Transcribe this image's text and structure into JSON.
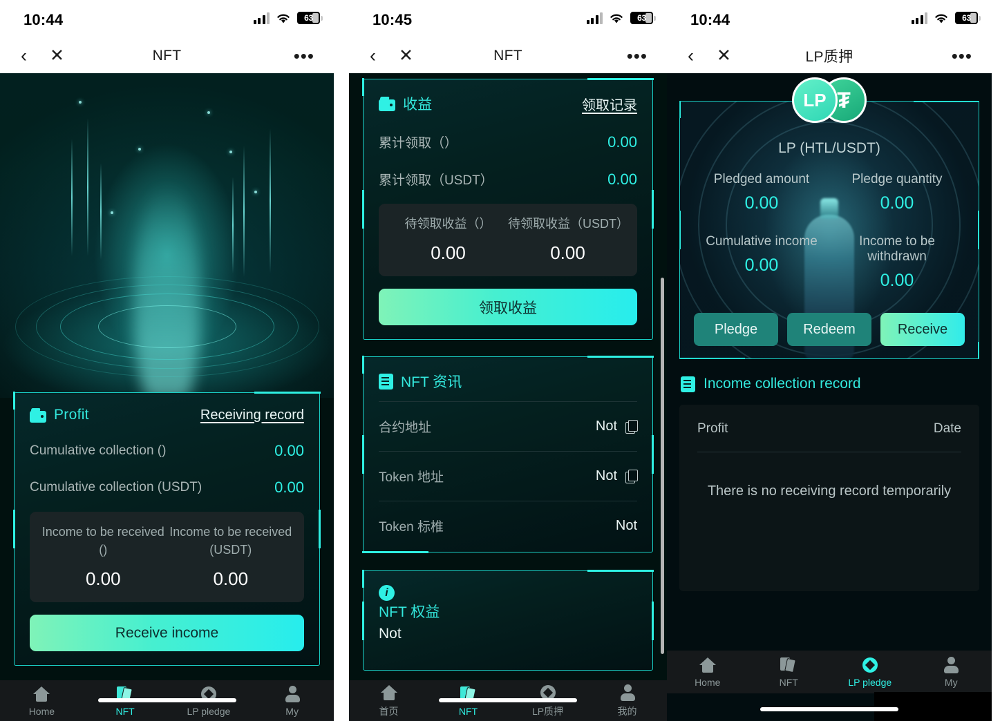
{
  "status_bar": {
    "time_1": "10:44",
    "time_2": "10:45",
    "time_3": "10:44",
    "battery": "63"
  },
  "panel1": {
    "nav": {
      "back": "‹",
      "close": "✕",
      "title": "NFT",
      "more": "•••"
    },
    "hero_alt": "nft-portal-artwork",
    "profit_card": {
      "icon": "wallet-icon",
      "title": "Profit",
      "record_link": "Receiving record",
      "rows": [
        {
          "label": "Cumulative collection ()",
          "value": "0.00"
        },
        {
          "label": "Cumulative collection (USDT)",
          "value": "0.00"
        }
      ],
      "pending": [
        {
          "label": "Income to be received ()",
          "value": "0.00"
        },
        {
          "label": "Income to be received (USDT)",
          "value": "0.00"
        }
      ],
      "button": "Receive income"
    },
    "tabs": [
      {
        "label": "Home",
        "icon": "home-icon",
        "active": false
      },
      {
        "label": "NFT",
        "icon": "nft-cards-icon",
        "active": true
      },
      {
        "label": "LP pledge",
        "icon": "lp-diamond-icon",
        "active": false
      },
      {
        "label": "My",
        "icon": "person-icon",
        "active": false
      }
    ]
  },
  "panel2": {
    "nav": {
      "back": "‹",
      "close": "✕",
      "title": "NFT",
      "more": "•••"
    },
    "income_card": {
      "icon": "wallet-icon",
      "title": "收益",
      "record_link": "领取记录",
      "rows": [
        {
          "label": "累计领取（）",
          "value": "0.00"
        },
        {
          "label": "累计领取（USDT）",
          "value": "0.00"
        }
      ],
      "pending": [
        {
          "label": "待领取收益（）",
          "value": "0.00"
        },
        {
          "label": "待领取收益（USDT）",
          "value": "0.00"
        }
      ],
      "button": "领取收益"
    },
    "info_card": {
      "icon": "document-icon",
      "title": "NFT 资讯",
      "rows": [
        {
          "label": "合约地址",
          "value": "Not",
          "copy": true
        },
        {
          "label": "Token 地址",
          "value": "Not",
          "copy": true
        },
        {
          "label": "Token 标椎",
          "value": "Not",
          "copy": false
        }
      ]
    },
    "rights_card": {
      "icon": "info-icon",
      "title": "NFT 权益",
      "body": "Not"
    },
    "tabs": [
      {
        "label": "首页",
        "icon": "home-icon",
        "active": false
      },
      {
        "label": "NFT",
        "icon": "nft-cards-icon",
        "active": true
      },
      {
        "label": "LP质押",
        "icon": "lp-diamond-icon",
        "active": false
      },
      {
        "label": "我的",
        "icon": "person-icon",
        "active": false
      }
    ]
  },
  "panel3": {
    "nav": {
      "back": "‹",
      "close": "✕",
      "title": "LP质押",
      "more": "•••"
    },
    "lp_card": {
      "token_left": "LP",
      "token_right": "₮",
      "pair_title": "LP (HTL/USDT)",
      "stats": [
        {
          "label": "Pledged amount",
          "value": "0.00"
        },
        {
          "label": "Pledge quantity",
          "value": "0.00"
        },
        {
          "label": "Cumulative income",
          "value": "0.00"
        },
        {
          "label": "Income to be withdrawn",
          "value": "0.00"
        }
      ],
      "buttons": [
        {
          "label": "Pledge",
          "primary": false
        },
        {
          "label": "Redeem",
          "primary": false
        },
        {
          "label": "Receive",
          "primary": true
        }
      ]
    },
    "record_section": {
      "icon": "list-icon",
      "title": "Income collection record",
      "columns": [
        "Profit",
        "Date"
      ],
      "empty": "There is no receiving record temporarily"
    },
    "tabs": [
      {
        "label": "Home",
        "icon": "home-icon",
        "active": false
      },
      {
        "label": "NFT",
        "icon": "nft-cards-icon",
        "active": false
      },
      {
        "label": "LP pledge",
        "icon": "lp-diamond-icon",
        "active": true
      },
      {
        "label": "My",
        "icon": "person-icon",
        "active": false
      }
    ]
  },
  "colors": {
    "accent": "#2ff0e4",
    "border": "#1ad0c6",
    "bg": "#01110f",
    "btn_start": "#7ff3b8",
    "btn_end": "#27eded"
  }
}
